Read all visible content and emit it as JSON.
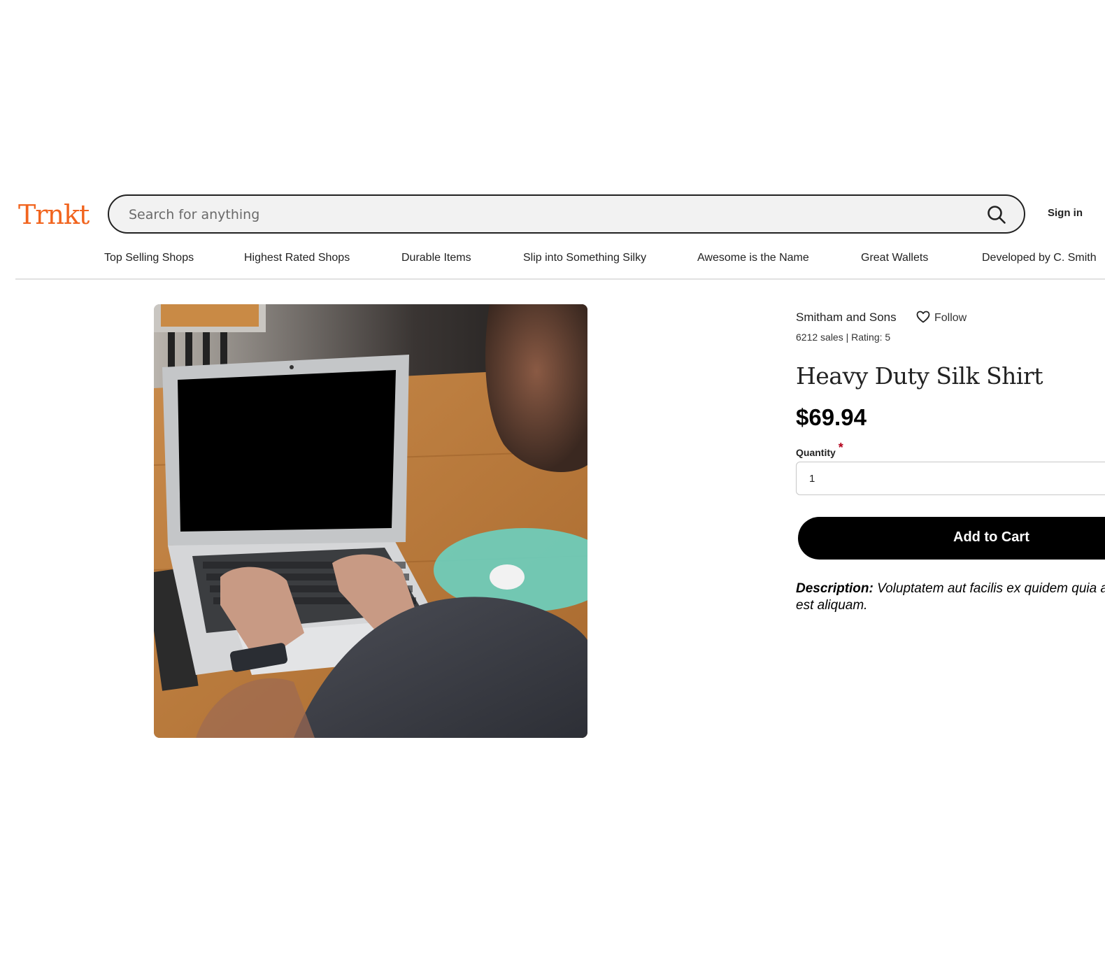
{
  "header": {
    "logo": "Trnkt",
    "search_placeholder": "Search for anything",
    "search_value": "",
    "sign_in_label": "Sign in"
  },
  "categories": [
    "Top Selling Shops",
    "Highest Rated Shops",
    "Durable Items",
    "Slip into Something Silky",
    "Awesome is the Name",
    "Great Wallets",
    "Developed by C. Smith"
  ],
  "shop": {
    "name": "Smitham and Sons",
    "follow_label": "Follow",
    "stats": "6212 sales | Rating: 5"
  },
  "product": {
    "title": "Heavy Duty Silk Shirt",
    "price": "$69.94",
    "quantity_label": "Quantity",
    "required_mark": "*",
    "quantity_value": "1",
    "add_to_cart_label": "Add to Cart",
    "description_label": "Description:",
    "description_text": "Voluptatem aut facilis ex quidem quia aut iure est aliquam.",
    "image_subject": "person typing on a laptop at a wooden table"
  },
  "colors": {
    "brand": "#f1641e",
    "button": "#000000",
    "required": "#b3001b"
  },
  "icons": {
    "search": "search-icon",
    "follow": "heart-icon"
  }
}
